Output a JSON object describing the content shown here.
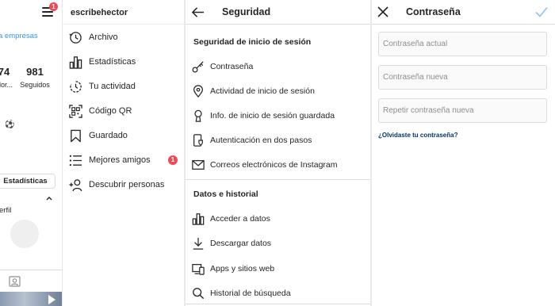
{
  "profile_panel": {
    "notification_count": "1",
    "business_link": "a empresas",
    "followers": {
      "value": "74",
      "label": "dor..."
    },
    "following": {
      "value": "981",
      "label": "Seguidos"
    },
    "stats_button": "Estadísticas",
    "perfil_label": "erfil"
  },
  "drawer": {
    "username": "escribehector",
    "items": [
      {
        "label": "Archivo",
        "icon": "archive-icon"
      },
      {
        "label": "Estadísticas",
        "icon": "insights-icon"
      },
      {
        "label": "Tu actividad",
        "icon": "activity-icon"
      },
      {
        "label": "Código QR",
        "icon": "qr-code-icon"
      },
      {
        "label": "Guardado",
        "icon": "bookmark-icon"
      },
      {
        "label": "Mejores amigos",
        "icon": "close-friends-icon",
        "badge": "1"
      },
      {
        "label": "Descubrir personas",
        "icon": "add-person-icon"
      }
    ]
  },
  "security": {
    "title": "Seguridad",
    "login_section": "Seguridad de inicio de sesión",
    "login_items": [
      {
        "label": "Contraseña",
        "icon": "key-icon"
      },
      {
        "label": "Actividad de inicio de sesión",
        "icon": "location-pin-icon"
      },
      {
        "label": "Info. de inicio de sesión guardada",
        "icon": "keyhole-icon"
      },
      {
        "label": "Autenticación en dos pasos",
        "icon": "phone-shield-icon"
      },
      {
        "label": "Correos electrónicos de Instagram",
        "icon": "mail-icon"
      }
    ],
    "data_section": "Datos e historial",
    "data_items": [
      {
        "label": "Acceder a datos",
        "icon": "bar-chart-icon"
      },
      {
        "label": "Descargar datos",
        "icon": "download-icon"
      },
      {
        "label": "Apps y sitios web",
        "icon": "devices-icon"
      },
      {
        "label": "Historial de búsqueda",
        "icon": "search-icon"
      }
    ]
  },
  "password": {
    "title": "Contraseña",
    "current_placeholder": "Contraseña actual",
    "new_placeholder": "Contraseña nueva",
    "repeat_placeholder": "Repetir contraseña nueva",
    "forgot_link": "¿Olvidaste tu contraseña?"
  },
  "colors": {
    "accent_blue": "#3897f0",
    "notification_red": "#ed4956",
    "link_dark_blue": "#003569",
    "border": "#dbdbdb"
  }
}
